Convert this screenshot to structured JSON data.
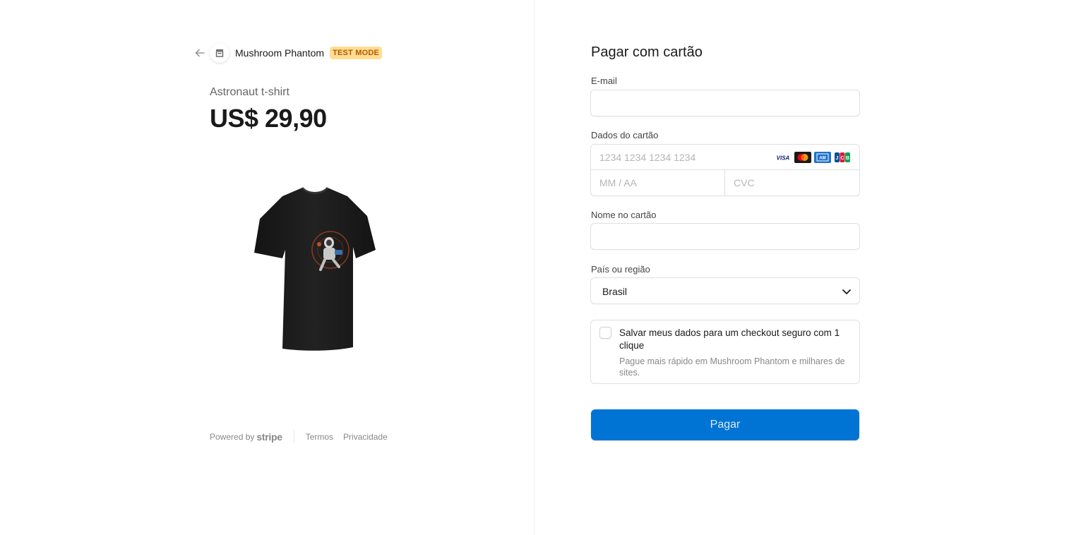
{
  "header": {
    "back_icon": "arrow-left-icon",
    "store_icon": "store-icon",
    "merchant_name": "Mushroom Phantom",
    "test_badge": "TEST MODE"
  },
  "product": {
    "name": "Astronaut t-shirt",
    "price": "US$ 29,90",
    "image_icon": "tshirt-image"
  },
  "footer": {
    "powered_by": "Powered by",
    "stripe": "stripe",
    "terms": "Termos",
    "privacy": "Privacidade"
  },
  "form": {
    "title": "Pagar com cartão",
    "email_label": "E-mail",
    "email_value": "",
    "card_label": "Dados do cartão",
    "card_number_placeholder": "1234 1234 1234 1234",
    "expiry_placeholder": "MM / AA",
    "cvc_placeholder": "CVC",
    "card_brands": [
      "VISA",
      "mastercard",
      "amex",
      "JCB"
    ],
    "name_label": "Nome no cartão",
    "name_value": "",
    "country_label": "País ou região",
    "country_value": "Brasil",
    "save_title": "Salvar meus dados para um checkout seguro com 1 clique",
    "save_desc": "Pague mais rápido em Mushroom Phantom e milhares de sites.",
    "save_checked": false,
    "pay_button": "Pagar"
  },
  "colors": {
    "accent": "#0074d4",
    "badge_bg": "#ffde92",
    "badge_text": "#bb5504"
  }
}
